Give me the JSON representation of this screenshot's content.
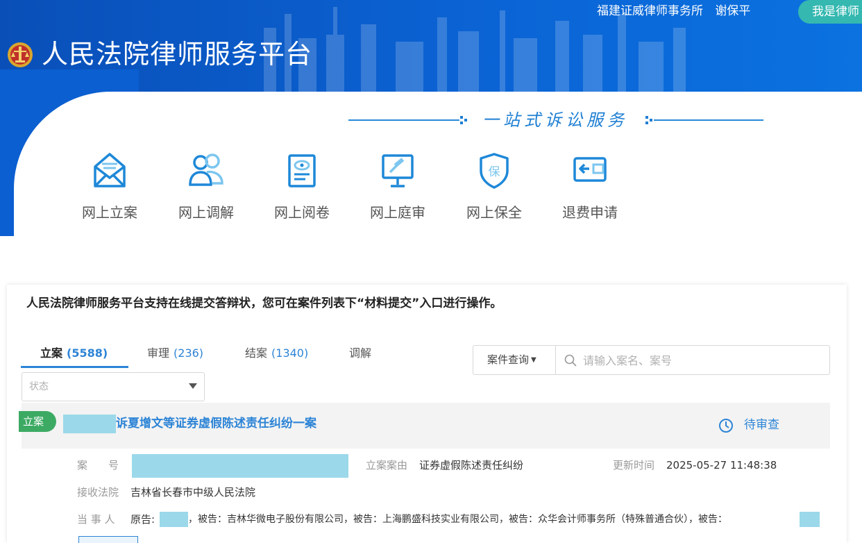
{
  "header": {
    "title": "人民法院律师服务平台",
    "firm": "福建证威律师事务所",
    "user": "谢保平",
    "lawyer_button": "我是律师"
  },
  "slogan": "一站式诉讼服务",
  "services": [
    {
      "label": "网上立案",
      "icon": "envelope-icon"
    },
    {
      "label": "网上调解",
      "icon": "people-icon"
    },
    {
      "label": "网上阅卷",
      "icon": "document-eye-icon"
    },
    {
      "label": "网上庭审",
      "icon": "gavel-screen-icon"
    },
    {
      "label": "网上保全",
      "icon": "shield-icon"
    },
    {
      "label": "退费申请",
      "icon": "wallet-refund-icon"
    }
  ],
  "notice": "人民法院律师服务平台支持在线提交答辩状，您可在案件列表下“材料提交”入口进行操作。",
  "tabs": [
    {
      "label": "立案",
      "count": "(5588)",
      "active": true
    },
    {
      "label": "审理",
      "count": "(236)",
      "active": false
    },
    {
      "label": "结案",
      "count": "(1340)",
      "active": false
    },
    {
      "label": "调解",
      "count": "",
      "active": false
    }
  ],
  "search": {
    "query_type": "案件查询",
    "placeholder": "请输入案名、案号",
    "value": ""
  },
  "status_filter": {
    "placeholder": "状态"
  },
  "case": {
    "badge": "立案",
    "title": "诉夏增文等证券虚假陈述责任纠纷一案",
    "status": "待审查",
    "case_no_label": "案　　号",
    "cause_label": "立案案由",
    "cause": "证券虚假陈述责任纠纷",
    "updated_label": "更新时间",
    "updated": "2025-05-27 11:48:38",
    "court_label": "接收法院",
    "court": "吉林省长春市中级人民法院",
    "parties_label": "当 事 人",
    "parties": [
      "原告:",
      "，被告：吉林华微电子股份有限公司，被告：上海鹏盛科技实业有限公司，被告：众华会计师事务所（特殊普通合伙），被告："
    ]
  },
  "colors": {
    "header_blue": "#0b5fd0",
    "accent_blue": "#2d84d6",
    "badge_green": "#3daa63",
    "lawyer_teal": "#34b8b0"
  }
}
